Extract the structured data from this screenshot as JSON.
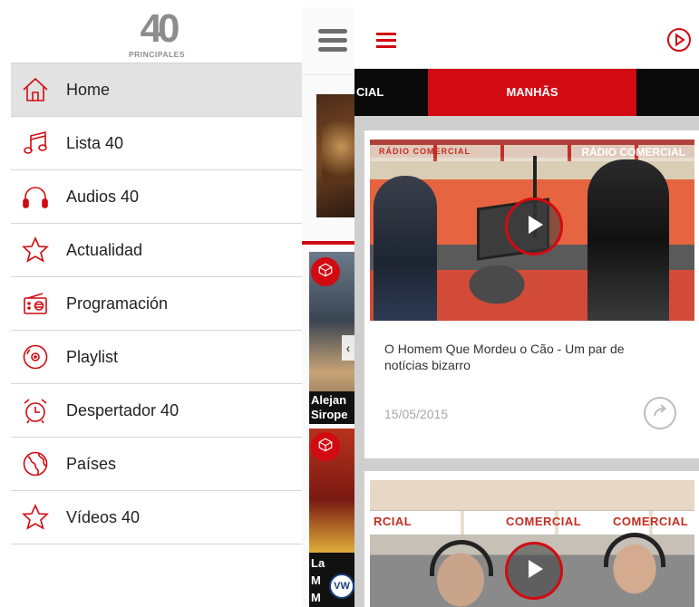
{
  "logo": {
    "primary": "40",
    "secondary": "PRINCIPALES"
  },
  "menu": {
    "items": [
      {
        "label": "Home",
        "icon": "home-icon",
        "active": true
      },
      {
        "label": "Lista 40",
        "icon": "music-note-icon"
      },
      {
        "label": "Audios 40",
        "icon": "headphones-icon"
      },
      {
        "label": "Actualidad",
        "icon": "star-icon"
      },
      {
        "label": "Programación",
        "icon": "radio-icon"
      },
      {
        "label": "Playlist",
        "icon": "disc-icon"
      },
      {
        "label": "Despertador 40",
        "icon": "alarm-clock-icon"
      },
      {
        "label": "Países",
        "icon": "globe-icon"
      },
      {
        "label": "Vídeos 40",
        "icon": "star-outline-icon"
      }
    ]
  },
  "middle": {
    "caption_a": "Alejan\nSirope",
    "caption_b": "La\nM\nM",
    "vw_logo": "VW"
  },
  "tabs": {
    "prev_partial": "CIAL",
    "active": "MANHÃS"
  },
  "feed": {
    "cards": [
      {
        "title": "O Homem Que Mordeu o Cão - Um par de notícias bizarro",
        "date": "15/05/2015",
        "thumb_text_left": "RÁDIO COMERCIAL",
        "thumb_text_right": "RÁDIO COMERCIAL"
      },
      {
        "banner_left": "RCIAL",
        "banner_mid": "COMERCIAL",
        "banner_right": "COMERCIAL"
      }
    ]
  },
  "colors": {
    "accent": "#d20a11",
    "tab_bar": "#0a0a0a",
    "feed_bg": "#cfcfcf"
  }
}
